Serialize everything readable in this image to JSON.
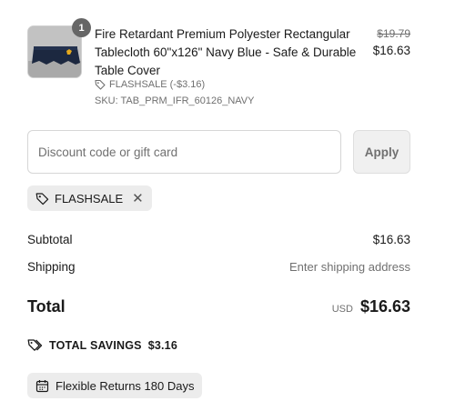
{
  "cart_item": {
    "quantity": "1",
    "title": "Fire Retardant Premium Polyester Rectangular Tablecloth 60\"x126\" Navy Blue - Safe & Durable Table Cover",
    "discount_label": "FLASHSALE (-$3.16)",
    "sku": "SKU: TAB_PRM_IFR_60126_NAVY",
    "compare_price": "$19.79",
    "final_price": "$16.63"
  },
  "discount": {
    "placeholder": "Discount code or gift card",
    "apply_label": "Apply",
    "applied_code": "FLASHSALE"
  },
  "summary": {
    "subtotal_label": "Subtotal",
    "subtotal_value": "$16.63",
    "shipping_label": "Shipping",
    "shipping_value": "Enter shipping address",
    "total_label": "Total",
    "currency": "USD",
    "total_value": "$16.63",
    "savings_label": "TOTAL SAVINGS",
    "savings_value": "$3.16"
  },
  "returns": {
    "label": "Flexible Returns 180 Days"
  },
  "icons": {
    "discount_tag": "tag-icon",
    "remove_code": "close-icon",
    "savings": "tags-icon",
    "returns": "calendar-icon"
  },
  "colors": {
    "text": "#1a1a1a",
    "muted": "#707070",
    "chip_bg": "#ececec",
    "badge": "#666666",
    "border": "#d6d6d6",
    "product_navy": "#1c2840"
  }
}
